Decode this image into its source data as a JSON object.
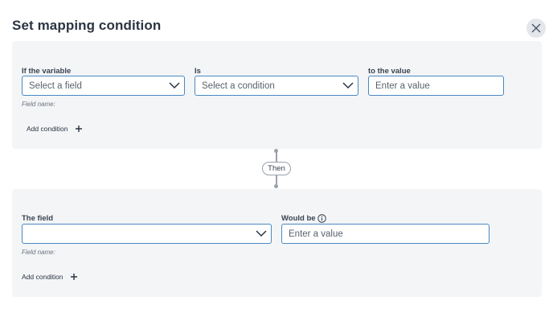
{
  "dialog": {
    "title": "Set mapping condition"
  },
  "if_section": {
    "variable_label": "If the variable",
    "variable_placeholder": "Select a field",
    "is_label": "Is",
    "condition_placeholder": "Select a condition",
    "value_label": "to the value",
    "value_placeholder": "Enter a value",
    "field_name_hint": "Field name:",
    "add_condition_label": "Add condition"
  },
  "connector": {
    "label": "Then"
  },
  "then_section": {
    "field_label": "The field",
    "field_value": "",
    "would_be_label": "Would be",
    "would_be_placeholder": "Enter a value",
    "field_name_hint": "Field name:",
    "add_condition_label": "Add condition"
  },
  "colors": {
    "accent_border": "#4a89c2",
    "panel_bg": "#f3f5f7",
    "text": "#2b3542"
  },
  "icons": [
    "close-icon",
    "chevron-down-icon",
    "plus-icon",
    "info-icon"
  ]
}
